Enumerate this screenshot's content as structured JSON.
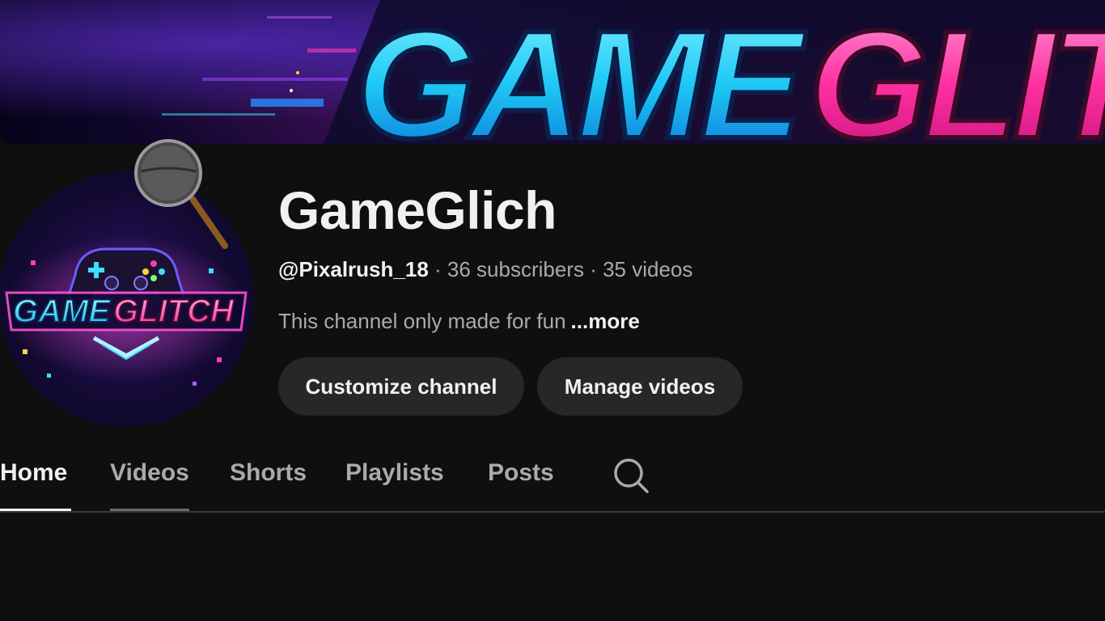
{
  "banner": {
    "text_cyan": "GAME",
    "text_pink": "GLIT"
  },
  "avatar": {
    "logo_text_cyan": "GAME",
    "logo_text_pink": "GLITCH"
  },
  "channel": {
    "name": "GameGlich",
    "handle": "@Pixalrush_18",
    "separator1": " · ",
    "subscribers": "36 subscribers",
    "separator2": " · ",
    "videos": "35 videos",
    "description": "This channel only made for fun",
    "more_label": "...more"
  },
  "actions": {
    "customize_label": "Customize channel",
    "manage_label": "Manage videos"
  },
  "tabs": {
    "home": "Home",
    "videos": "Videos",
    "shorts": "Shorts",
    "playlists": "Playlists",
    "posts": "Posts",
    "active": "Home"
  },
  "icons": {
    "search": "search-icon",
    "magnifier": "magnifier-cursor-icon",
    "controller": "gamepad-icon"
  },
  "colors": {
    "background": "#0f0f0f",
    "button_bg": "#272727",
    "text_primary": "#f1f1f1",
    "text_secondary": "#aaaaaa",
    "brand_cyan": "#22d3ff",
    "brand_pink": "#ff2fa0"
  }
}
